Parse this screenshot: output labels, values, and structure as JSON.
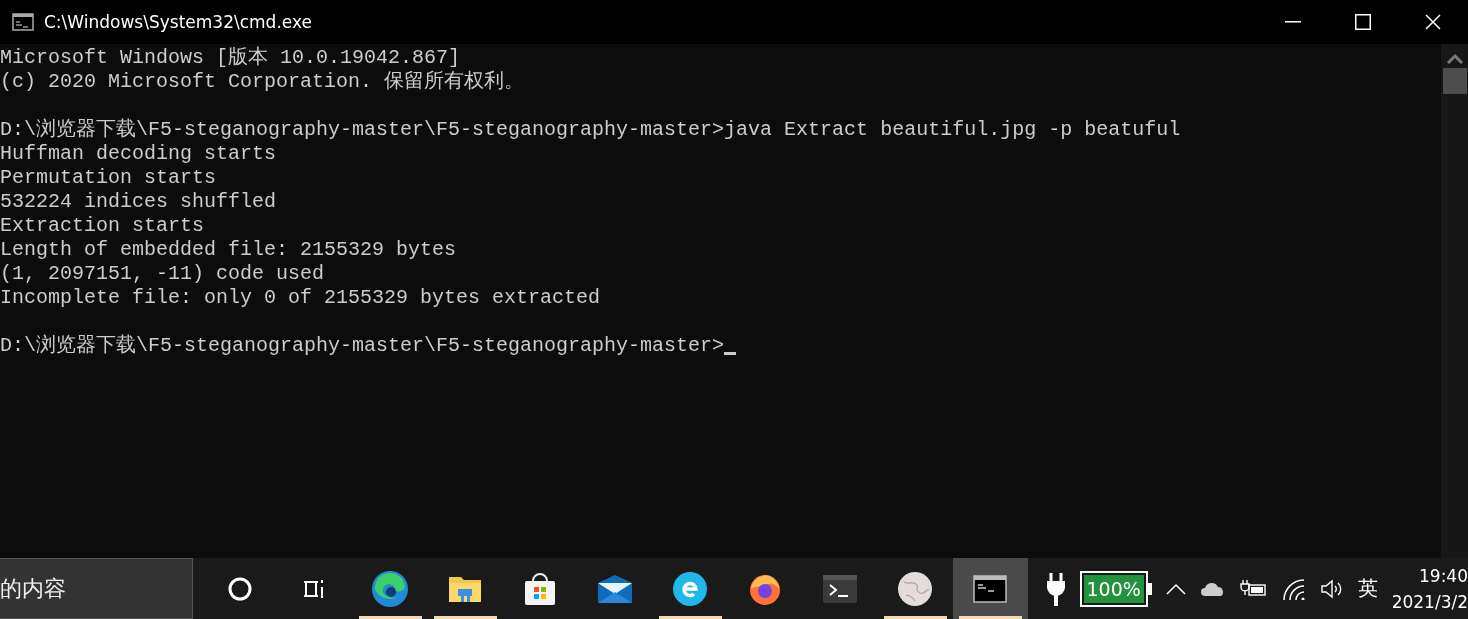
{
  "window": {
    "title": "C:\\Windows\\System32\\cmd.exe"
  },
  "console": {
    "lines": [
      {
        "kind": "output",
        "text": "Microsoft Windows [版本 10.0.19042.867]"
      },
      {
        "kind": "output",
        "text": "(c) 2020 Microsoft Corporation. 保留所有权利。"
      },
      {
        "kind": "blank"
      },
      {
        "kind": "output",
        "text": "D:\\浏览器下载\\F5-steganography-master\\F5-steganography-master>java Extract beautiful.jpg -p beatuful"
      },
      {
        "kind": "output",
        "text": "Huffman decoding starts"
      },
      {
        "kind": "output",
        "text": "Permutation starts"
      },
      {
        "kind": "output",
        "text": "532224 indices shuffled"
      },
      {
        "kind": "output",
        "text": "Extraction starts"
      },
      {
        "kind": "output",
        "text": "Length of embedded file: 2155329 bytes"
      },
      {
        "kind": "output",
        "text": "(1, 2097151, -11) code used"
      },
      {
        "kind": "output",
        "text": "Incomplete file: only 0 of 2155329 bytes extracted"
      },
      {
        "kind": "blank"
      },
      {
        "kind": "prompt",
        "text": "D:\\浏览器下载\\F5-steganography-master\\F5-steganography-master>",
        "cursor": true
      }
    ]
  },
  "taskbar": {
    "search": {
      "value": "的内容"
    },
    "apps": [
      {
        "kind": "cortana",
        "running": false,
        "selected": false
      },
      {
        "kind": "taskview",
        "running": false,
        "selected": false
      },
      {
        "kind": "edge",
        "running": true,
        "selected": false
      },
      {
        "kind": "explorer",
        "running": true,
        "selected": false
      },
      {
        "kind": "store",
        "running": false,
        "selected": false
      },
      {
        "kind": "mail",
        "running": false,
        "selected": false
      },
      {
        "kind": "browser360",
        "running": true,
        "selected": false
      },
      {
        "kind": "firefox",
        "running": false,
        "selected": false
      },
      {
        "kind": "terminal",
        "running": false,
        "selected": false
      },
      {
        "kind": "globe",
        "running": true,
        "selected": false
      },
      {
        "kind": "cmd",
        "running": true,
        "selected": true
      }
    ],
    "battery": {
      "text": "100%",
      "level": 1
    },
    "ime": "英",
    "time": "19:40",
    "date": "2021/3/2"
  }
}
